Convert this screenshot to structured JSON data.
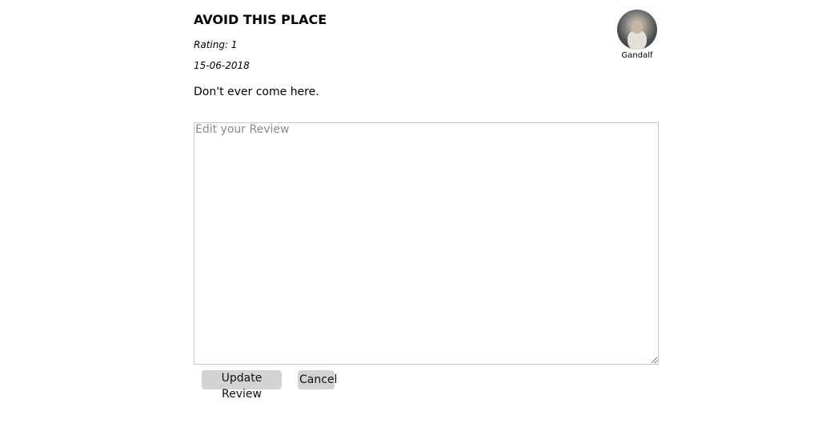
{
  "review": {
    "title": "AVOID THIS PLACE",
    "rating": "Rating: 1",
    "date": "15-06-2018",
    "text": "Don't ever come here."
  },
  "author": {
    "name": "Gandalf",
    "avatar": "wizard-portrait-avatar"
  },
  "editor": {
    "value": "",
    "placeholder": "Edit your Review"
  },
  "actions": {
    "update_label": "Update Review",
    "cancel_label": "Cancel"
  },
  "colors": {
    "button_bg": "#d3d3d3",
    "border": "#c8c8c8",
    "placeholder": "#8a8a8a"
  }
}
